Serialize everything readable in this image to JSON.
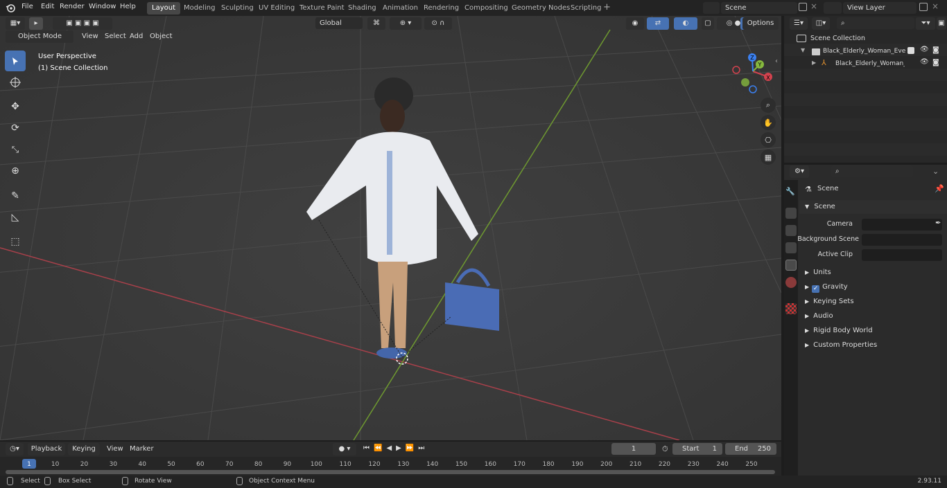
{
  "topbar": {
    "menus": [
      "File",
      "Edit",
      "Render",
      "Window",
      "Help"
    ],
    "workspaces": [
      "Layout",
      "Modeling",
      "Sculpting",
      "UV Editing",
      "Texture Paint",
      "Shading",
      "Animation",
      "Rendering",
      "Compositing",
      "Geometry Nodes",
      "Scripting"
    ],
    "active_workspace": "Layout",
    "scene_name": "Scene",
    "view_layer": "View Layer"
  },
  "viewport": {
    "mode": "Object Mode",
    "menus": [
      "View",
      "Select",
      "Add",
      "Object"
    ],
    "transform_orientation": "Global",
    "options_label": "Options",
    "perspective_label": "User Perspective",
    "collection_label": "(1) Scene Collection",
    "gizmo_axes": [
      "X",
      "Y",
      "Z"
    ]
  },
  "outliner": {
    "root": "Scene Collection",
    "items": [
      "Black_Elderly_Woman_Everyd",
      "Black_Elderly_Woman_E"
    ]
  },
  "properties": {
    "context_title": "Scene",
    "panel_title": "Scene",
    "fields": [
      {
        "label": "Camera",
        "value": ""
      },
      {
        "label": "Background Scene",
        "value": ""
      },
      {
        "label": "Active Clip",
        "value": ""
      }
    ],
    "subpanels": [
      "Units",
      "Gravity",
      "Keying Sets",
      "Audio",
      "Rigid Body World",
      "Custom Properties"
    ],
    "gravity_checked": true
  },
  "timeline": {
    "menus": [
      "Playback",
      "Keying",
      "View",
      "Marker"
    ],
    "current_frame": "1",
    "start_label": "Start",
    "start_value": "1",
    "end_label": "End",
    "end_value": "250",
    "ticks": [
      "1",
      "10",
      "20",
      "30",
      "40",
      "50",
      "60",
      "70",
      "80",
      "90",
      "100",
      "110",
      "120",
      "130",
      "140",
      "150",
      "160",
      "170",
      "180",
      "190",
      "200",
      "210",
      "220",
      "230",
      "240",
      "250"
    ]
  },
  "statusbar": {
    "select": "Select",
    "box_select": "Box Select",
    "rotate_view": "Rotate View",
    "context_menu": "Object Context Menu",
    "version": "2.93.11"
  },
  "colors": {
    "accent": "#4772b3",
    "x_axis": "#d2424e",
    "y_axis": "#86b83e",
    "z_axis": "#3b80f0"
  }
}
